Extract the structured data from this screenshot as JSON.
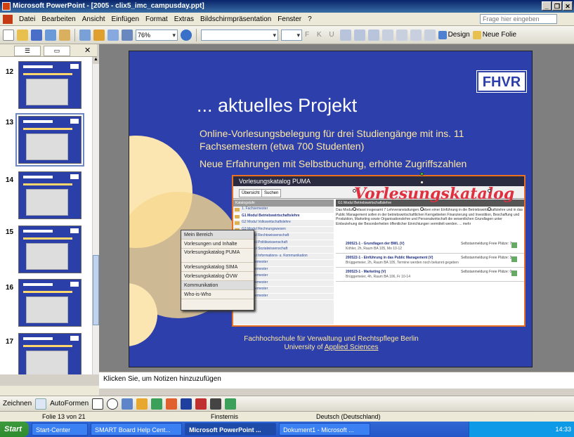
{
  "window": {
    "title": "Microsoft PowerPoint - [2005 - clix5_imc_campusday.ppt]"
  },
  "menu": [
    "Datei",
    "Bearbeiten",
    "Ansicht",
    "Einfügen",
    "Format",
    "Extras",
    "Bildschirmpräsentation",
    "Fenster",
    "?"
  ],
  "help_placeholder": "Frage hier eingeben",
  "toolbar": {
    "zoom": "76%",
    "design": "Design",
    "new_slide": "Neue Folie",
    "format_letters": "F K U"
  },
  "thumbnails": [
    "12",
    "13",
    "14",
    "15",
    "16",
    "17"
  ],
  "slide": {
    "logo": "FHVR",
    "title": "... aktuelles Projekt",
    "line1": "Online-Vorlesungsbelegung für drei Studiengänge mit ins. 11 Fachsemestern (etwa 700 Studenten)",
    "line2": "Neue Erfahrungen mit Selbstbuchung, erhöhte Zugriffszahlen",
    "footer1": "Fachhochschule für Verwaltung und Rechtspflege Berlin",
    "footer2a": "University of ",
    "footer2b": "Applied Sciences"
  },
  "screenshot": {
    "header": "Vorlesungskatalog PUMA",
    "tabs": [
      "Übersicht",
      "Suchen"
    ],
    "left_header": "Katalogstufe",
    "tree": [
      "1. Fachsemester",
      "G1 Modul Betriebswirtschaftslehre",
      "G2 Modul Volkswirtschaftslehre",
      "G3 Modul Rechnungswesen",
      "G4 Modul Rechtswissenschaft",
      "G5 Modul Politikwissenschaft",
      "G6 Modul Sozialwissenschaft",
      "G8 Modul Informations- u. Kommunikation",
      "2. Fachsemester",
      "3. Fachsemester",
      "4. Fachsemester",
      "5. Fachsemester",
      "6. Fachsemester",
      "7. Fachsemester"
    ],
    "right_header": "G1 Modul Betriebswirtschaftslehre",
    "description": "Das Modul umfasst insgesamt 7 Lehrveranstaltungen. Neben einer Einführung in die Betriebswirtschaftslehre und in das Public Management sollen in der betriebswirtschaftlichen Kerngebieten Finanzierung und Investition, Beschaffung und Produktion, Marketing sowie Organisationslehre und Personalwirtschaft die wesentlichen Grundlagen unter Einbeziehung der Besonderheiten öffentlicher Einrichtungen vermittelt werden. ... mehr",
    "courses": [
      {
        "title": "200521-1 - Grundlagen der BWL (V)",
        "detail": "Köhler, 2h, Raum BA 105, Mo 10-12",
        "status": "Selbstanmeldung Freie Plätze: 7"
      },
      {
        "title": "200522-1 - Einführung in das Public Management (V)",
        "detail": "Brüggemeier, 2h, Raum BA 105, Termine werden noch bekannt gegeben",
        "status": "Selbstanmeldung Freie Plätze: 3"
      },
      {
        "title": "200523-1 - Marketing (V)",
        "detail": "Brüggemeier, 4h, Raum BA 106, Fr 10-14",
        "status": "Selbstanmeldung Freie Plätze: 0"
      }
    ],
    "annotation": "Vorlesungskatalog"
  },
  "popup_menu": [
    "Mein Bereich",
    "Vorlesungen und Inhalte",
    "Vorlesungskatalog PUMA",
    "Vorlesungskatalog SIMA",
    "Vorlesungskatalog ÖVW",
    "Kommunikation",
    "Who-is-Who"
  ],
  "notes_placeholder": "Klicken Sie, um Notizen hinzuzufügen",
  "drawing": {
    "zeichnen": "Zeichnen",
    "autoformen": "AutoFormen"
  },
  "status": {
    "slide": "Folie 13 von 21",
    "theme": "Finsternis",
    "language": "Deutsch (Deutschland)"
  },
  "taskbar": {
    "start": "Start",
    "tasks": [
      "Start-Center",
      "SMART Board Help Cent...",
      "Microsoft PowerPoint ...",
      "Dokument1 - Microsoft ..."
    ],
    "clock": "14:33"
  }
}
